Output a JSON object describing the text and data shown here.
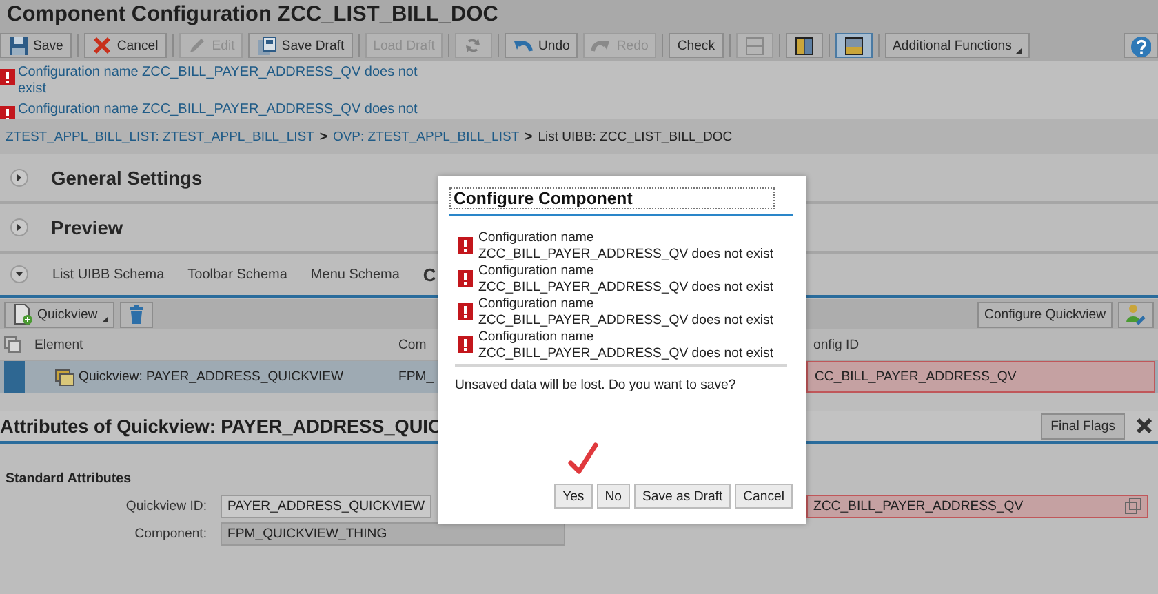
{
  "title": "Component Configuration ZCC_LIST_BILL_DOC",
  "toolbar": [
    {
      "kind": "save",
      "label": "Save",
      "disabled": false,
      "selected": false
    },
    {
      "kind": "cancel",
      "label": "Cancel",
      "disabled": false,
      "selected": false
    },
    {
      "kind": "edit",
      "label": "Edit",
      "disabled": true,
      "selected": false
    },
    {
      "kind": "draft",
      "label": "Save Draft",
      "disabled": false,
      "selected": false
    },
    {
      "kind": "text",
      "label": "Load Draft",
      "disabled": true,
      "selected": false
    },
    {
      "kind": "refresh",
      "disabled": true,
      "selected": false
    },
    {
      "kind": "undo",
      "label": "Undo",
      "disabled": false,
      "selected": false
    },
    {
      "kind": "redo",
      "label": "Redo",
      "disabled": true,
      "selected": false
    },
    {
      "kind": "text",
      "label": "Check",
      "disabled": false,
      "selected": false
    },
    {
      "kind": "rows",
      "disabled": true,
      "selected": false
    },
    {
      "kind": "columns",
      "disabled": false,
      "selected": false
    },
    {
      "kind": "split",
      "disabled": false,
      "selected": true
    },
    {
      "kind": "menu",
      "label": "Additional Functions",
      "disabled": false,
      "selected": false
    },
    {
      "kind": "help",
      "disabled": false,
      "selected": false
    }
  ],
  "messages": [
    "Configuration name ZCC_BILL_PAYER_ADDRESS_QV does not exist",
    "Configuration name ZCC_BILL_PAYER_ADDRESS_QV does not"
  ],
  "breadcrumb": [
    {
      "kind": "link",
      "text": "ZTEST_APPL_BILL_LIST: ZTEST_APPL_BILL_LIST"
    },
    {
      "kind": "separator",
      "text": ">"
    },
    {
      "kind": "link",
      "text": "OVP: ZTEST_APPL_BILL_LIST"
    },
    {
      "kind": "separator",
      "text": ">"
    },
    {
      "kind": "current",
      "text": "List UIBB: ZCC_LIST_BILL_DOC"
    }
  ],
  "sections": [
    {
      "title": "General Settings",
      "expanded": false
    },
    {
      "title": "Preview",
      "expanded": false
    }
  ],
  "schema": {
    "expanded": true,
    "tabs": [
      {
        "label": "List UIBB Schema",
        "selected": false
      },
      {
        "label": "Toolbar Schema",
        "selected": false
      },
      {
        "label": "Menu Schema",
        "selected": false
      },
      {
        "label": "C",
        "selected": true
      }
    ]
  },
  "table": {
    "add_button": "Quickview",
    "configure_button": "Configure Quickview",
    "columns": [
      "Element",
      "Com",
      "onfig ID"
    ],
    "rows": [
      {
        "selected": true,
        "cells": [
          {
            "text": "Quickview: PAYER_ADDRESS_QUICKVIEW",
            "error": false
          },
          {
            "text": "FPM_",
            "error": false
          },
          {
            "text": "CC_BILL_PAYER_ADDRESS_QV",
            "error": true
          }
        ]
      }
    ]
  },
  "attributes": {
    "title": "Attributes of Quickview: PAYER_ADDRESS_QUIC",
    "final_flags": "Final Flags",
    "group": "Standard Attributes",
    "fields": [
      {
        "label": "Quickview ID:",
        "value": "PAYER_ADDRESS_QUICKVIEW",
        "readonly": false,
        "config_value": "ZCC_BILL_PAYER_ADDRESS_QV",
        "config_error": true
      },
      {
        "label": "Component:",
        "value": "FPM_QUICKVIEW_THING",
        "readonly": true
      }
    ]
  },
  "dialog": {
    "title": "Configure Component",
    "messages": [
      {
        "line1": "Configuration name",
        "line2": "ZCC_BILL_PAYER_ADDRESS_QV does not exist"
      },
      {
        "line1": "Configuration name",
        "line2": "ZCC_BILL_PAYER_ADDRESS_QV does not exist"
      },
      {
        "line1": "Configuration name",
        "line2": "ZCC_BILL_PAYER_ADDRESS_QV does not exist"
      },
      {
        "line1": "Configuration name",
        "line2": "ZCC_BILL_PAYER_ADDRESS_QV does not exist"
      }
    ],
    "question": "Unsaved data will be lost. Do you want to save?",
    "buttons": [
      "Yes",
      "No",
      "Save as Draft",
      "Cancel"
    ]
  }
}
